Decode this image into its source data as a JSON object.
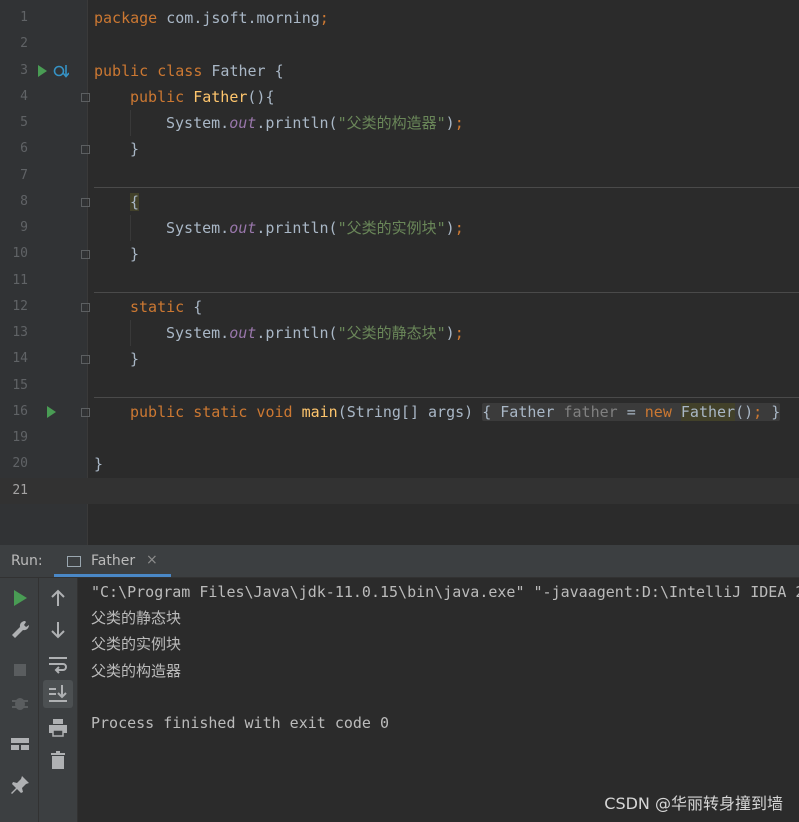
{
  "editor": {
    "lines": [
      {
        "n": "1"
      },
      {
        "n": "2"
      },
      {
        "n": "3"
      },
      {
        "n": "4"
      },
      {
        "n": "5"
      },
      {
        "n": "6"
      },
      {
        "n": "7"
      },
      {
        "n": "8"
      },
      {
        "n": "9"
      },
      {
        "n": "10"
      },
      {
        "n": "11"
      },
      {
        "n": "12"
      },
      {
        "n": "13"
      },
      {
        "n": "14"
      },
      {
        "n": "15"
      },
      {
        "n": "16"
      },
      {
        "n": "19"
      },
      {
        "n": "20"
      },
      {
        "n": "21"
      }
    ],
    "code": {
      "l1_kw": "package",
      "l1_rest": " com.jsoft.morning",
      "l1_semi": ";",
      "l3_kw": "public class ",
      "l3_name": "Father",
      "l3_rest": " {",
      "l4_kw": "public ",
      "l4_fn": "Father",
      "l4_rest": "(){",
      "l5_a": "System.",
      "l5_fld": "out",
      "l5_b": ".println(",
      "l5_str": "\"父类的构造器\"",
      "l5_c": ")",
      "l5_semi": ";",
      "l6": "}",
      "l8": "{",
      "l9_a": "System.",
      "l9_fld": "out",
      "l9_b": ".println(",
      "l9_str": "\"父类的实例块\"",
      "l9_c": ")",
      "l9_semi": ";",
      "l10": "}",
      "l12_kw": "static",
      "l12_rest": " {",
      "l13_a": "System.",
      "l13_fld": "out",
      "l13_b": ".println(",
      "l13_str": "\"父类的静态块\"",
      "l13_c": ")",
      "l13_semi": ";",
      "l14": "}",
      "l16_kw": "public static void ",
      "l16_fn": "main",
      "l16_args": "(String[] args) ",
      "l16_open": "{",
      "l16_type": " Father ",
      "l16_var": "father",
      "l16_eq": " = ",
      "l16_new": "new ",
      "l16_ctor": "Father",
      "l16_paren": "()",
      "l16_semi": ";",
      "l16_close": "}",
      "l20": "}"
    }
  },
  "run_panel": {
    "label": "Run:",
    "tab_label": "Father",
    "tab_close": "×",
    "console": [
      "\"C:\\Program Files\\Java\\jdk-11.0.15\\bin\\java.exe\" \"-javaagent:D:\\IntelliJ IDEA 2",
      "父类的静态块",
      "父类的实例块",
      "父类的构造器",
      "",
      "Process finished with exit code 0"
    ]
  },
  "watermark": "CSDN @华丽转身撞到墙",
  "colors": {
    "run_green": "#499c54",
    "keyword": "#cc7832",
    "string": "#6a8759",
    "field": "#9876aa",
    "function": "#ffc66d"
  }
}
